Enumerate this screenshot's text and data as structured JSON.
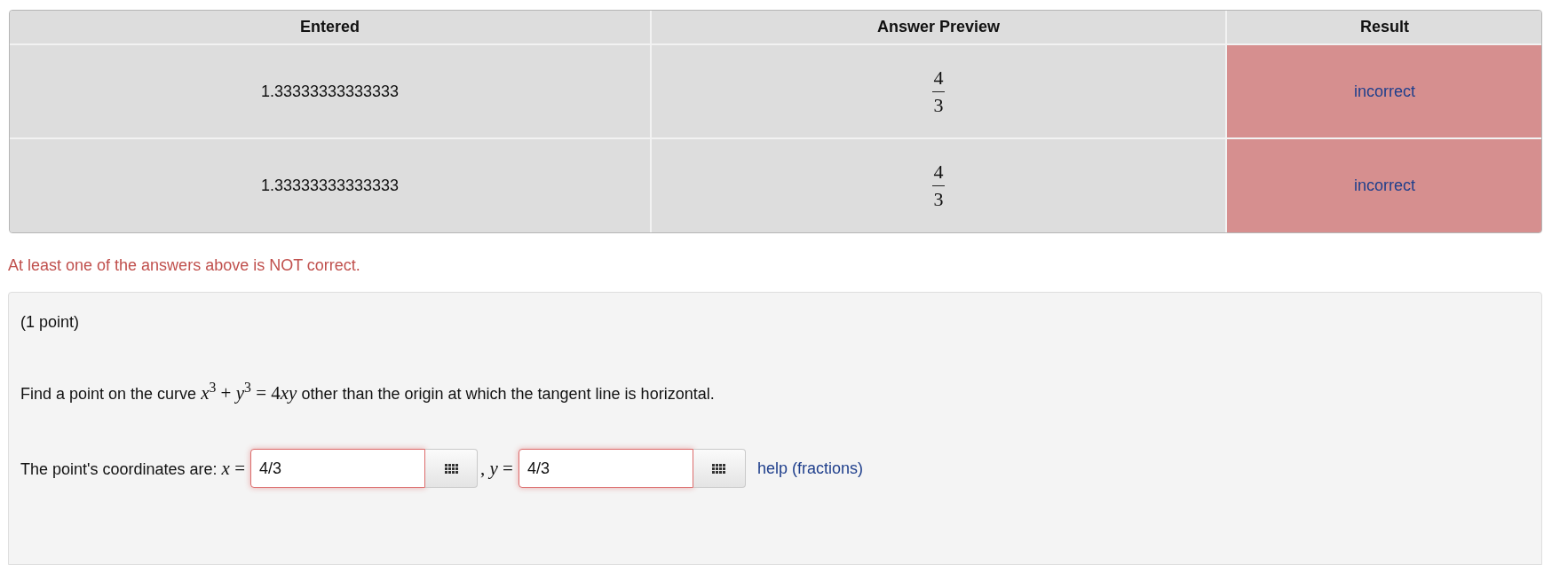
{
  "results_table": {
    "columns": [
      "Entered",
      "Answer Preview",
      "Result"
    ],
    "rows": [
      {
        "entered": "1.33333333333333",
        "preview": {
          "numerator": "4",
          "denominator": "3"
        },
        "result": "incorrect",
        "correct": false
      },
      {
        "entered": "1.33333333333333",
        "preview": {
          "numerator": "4",
          "denominator": "3"
        },
        "result": "incorrect",
        "correct": false
      }
    ]
  },
  "feedback_message": "At least one of the answers above is NOT correct.",
  "problem": {
    "points": "(1 point)",
    "statement": [
      {
        "kind": "text",
        "text": "Find a point on the curve"
      },
      {
        "kind": "math",
        "text": "*x*$^{3}$ + *y*$^{3}$ = 4"
      },
      {
        "kind": "math",
        "text": "*xy*"
      },
      {
        "kind": "text",
        "text": "other than the origin at which the tangent line is horizontal."
      }
    ],
    "answers": [
      {
        "label": [
          {
            "kind": "text",
            "text": "The point's coordinates are:"
          },
          {
            "kind": "math",
            "text": "*x* ="
          }
        ],
        "value": "4/3",
        "correct": false
      },
      {
        "label": [
          {
            "kind": "math",
            "text": ", *y* ="
          }
        ],
        "value": "4/3",
        "correct": false
      }
    ],
    "help_link": "help (fractions)"
  }
}
